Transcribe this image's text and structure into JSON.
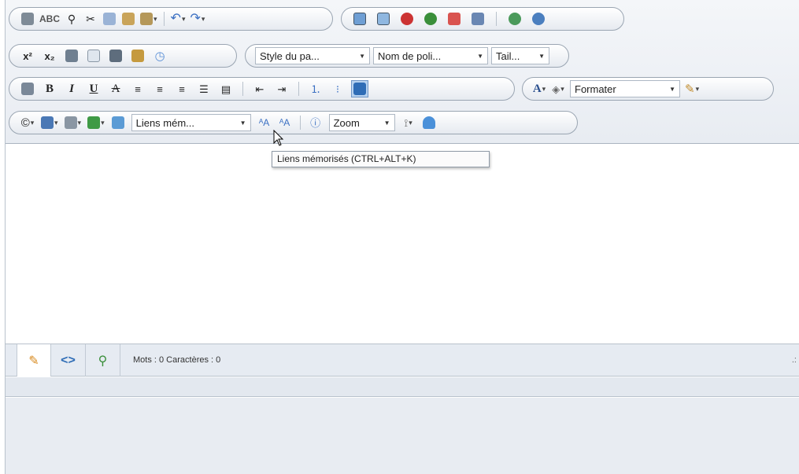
{
  "toolbar": {
    "row1": {
      "group1": [
        "print-icon",
        "spellcheck-icon",
        "find-icon",
        "cut-icon",
        "copy-icon",
        "paste-icon",
        "paste-special-icon",
        "undo-icon",
        "redo-icon"
      ],
      "group2": [
        "insert-image-icon",
        "image-gallery-icon",
        "flash-icon",
        "media-icon",
        "insert-document-icon",
        "template-icon",
        "user-icon",
        "users-icon"
      ]
    },
    "row2": {
      "superscript_label": "x²",
      "subscript_label": "x₂",
      "style_combo": "Style du pa...",
      "font_combo": "Nom de poli...",
      "size_combo": "Tail..."
    },
    "row3": {
      "bold_label": "B",
      "italic_label": "I",
      "underline_label": "U",
      "strike_label": "A",
      "fore_color_label": "A",
      "format_combo": "Formater"
    },
    "row4": {
      "links_combo": "Liens mém...",
      "zoom_combo": "Zoom"
    }
  },
  "tooltip": {
    "text": "Liens mémorisés (CTRL+ALT+K)"
  },
  "statusbar": {
    "word_count": "Mots : 0 Caractères : 0",
    "resize_glyph": ".:"
  },
  "colors": {
    "toolbar_bg": "#eef1f5",
    "group_border": "#9aa5b2",
    "statusbar_bg": "#e6ebf2"
  }
}
